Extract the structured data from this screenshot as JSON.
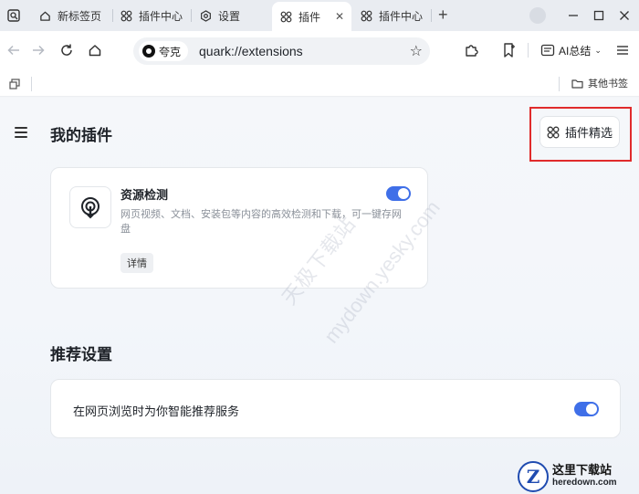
{
  "tabs": [
    {
      "label": "新标签页",
      "icon": "home-icon"
    },
    {
      "label": "插件中心",
      "icon": "extensions-icon"
    },
    {
      "label": "设置",
      "icon": "settings-icon"
    },
    {
      "label": "插件",
      "icon": "extensions-icon",
      "active": true
    },
    {
      "label": "插件中心",
      "icon": "extensions-icon"
    }
  ],
  "toolbar": {
    "site_chip": "夸克",
    "url": "quark://extensions",
    "ai_summary": "AI总结"
  },
  "bookmarks": {
    "other_bookmarks": "其他书签"
  },
  "page": {
    "title": "我的插件",
    "picks_button": "插件精选"
  },
  "extension": {
    "name": "资源检测",
    "description": "网页视频、文档、安装包等内容的高效检测和下载，可一键存网盘",
    "detail_button": "详情",
    "enabled": true
  },
  "recommend": {
    "section_title": "推荐设置",
    "option_label": "在网页浏览时为你智能推荐服务",
    "enabled": true
  },
  "watermark": {
    "line1": "天极下载站",
    "line2": "mydown.yesky.com"
  },
  "corner_logo": {
    "cn": "这里下载站",
    "en": "heredown.com",
    "badge": "Z"
  },
  "colors": {
    "accent": "#3f6fe8",
    "highlight": "#e02b2b"
  }
}
